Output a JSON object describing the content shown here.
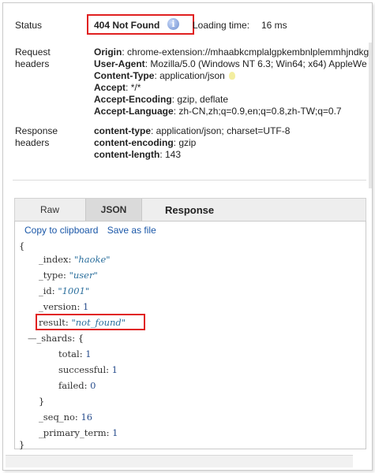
{
  "general": {
    "status_label": "Status",
    "status_value": "404 Not Found",
    "info_glyph": "i",
    "loading_label": "Loading time:",
    "loading_value": "16 ms"
  },
  "request_headers": {
    "label_line1": "Request",
    "label_line2": "headers",
    "items": [
      {
        "name": "Origin",
        "value": "chrome-extension://mhaabkcmplalgpkembnlplemmhjndkg"
      },
      {
        "name": "User-Agent",
        "value": "Mozilla/5.0 (Windows NT 6.3; Win64; x64) AppleWe"
      },
      {
        "name": "Content-Type",
        "value": "application/json"
      },
      {
        "name": "Accept",
        "value": "*/*"
      },
      {
        "name": "Accept-Encoding",
        "value": "gzip, deflate"
      },
      {
        "name": "Accept-Language",
        "value": "zh-CN,zh;q=0.9,en;q=0.8,zh-TW;q=0.7"
      }
    ]
  },
  "response_headers": {
    "label_line1": "Response",
    "label_line2": "headers",
    "items": [
      {
        "name": "content-type",
        "value": "application/json; charset=UTF-8"
      },
      {
        "name": "content-encoding",
        "value": "gzip"
      },
      {
        "name": "content-length",
        "value": "143"
      }
    ]
  },
  "tabs": {
    "raw": "Raw",
    "json": "JSON",
    "response": "Response",
    "active": "JSON"
  },
  "actions": {
    "copy": "Copy to clipboard",
    "save": "Save as file"
  },
  "json_view": {
    "open_brace": "{",
    "close_brace": "}",
    "index_key": "_index",
    "index_value": "\"haoke\"",
    "type_key": "_type",
    "type_value": "\"user\"",
    "id_key": "_id",
    "id_value": "\"1001\"",
    "version_key": "_version",
    "version_value": "1",
    "result_key": "result",
    "result_value": "\"not_found\"",
    "collapse_glyph": "—",
    "shards_key": "_shards",
    "shards_open": "{",
    "total_key": "total",
    "total_value": "1",
    "successful_key": "successful",
    "successful_value": "1",
    "failed_key": "failed",
    "failed_value": "0",
    "shards_close": "}",
    "seq_no_key": "_seq_no",
    "seq_no_value": "16",
    "primary_term_key": "_primary_term",
    "primary_term_value": "1"
  },
  "colors": {
    "highlight": "#e02020",
    "link": "#1a57a8"
  }
}
